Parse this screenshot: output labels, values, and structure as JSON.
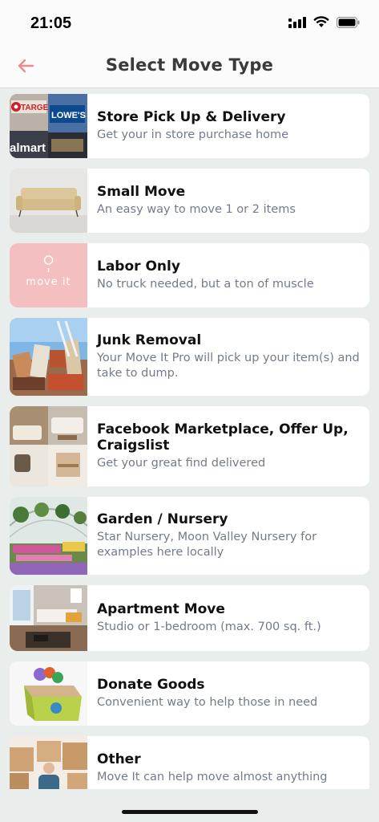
{
  "status": {
    "time": "21:05"
  },
  "nav": {
    "title": "Select Move Type",
    "back_icon": "arrow-left-icon",
    "accent": "#f08a8a"
  },
  "thumb_text": {
    "target": "TARGET",
    "lowes": "LOWE'S",
    "walmart": "almart",
    "moveit": "move it"
  },
  "items": [
    {
      "title": "Store Pick Up & Delivery",
      "subtitle": "Get your in store purchase home"
    },
    {
      "title": "Small Move",
      "subtitle": "An easy way to move 1 or 2 items"
    },
    {
      "title": "Labor Only",
      "subtitle": "No truck needed, but a ton of muscle"
    },
    {
      "title": "Junk Removal",
      "subtitle": "Your Move It Pro will pick up your item(s) and take to dump."
    },
    {
      "title": "Facebook Marketplace, Offer Up, Craigslist",
      "subtitle": "Get your great find delivered"
    },
    {
      "title": "Garden / Nursery",
      "subtitle": "Star Nursery, Moon Valley Nursery for examples here locally"
    },
    {
      "title": "Apartment Move",
      "subtitle": "Studio or 1-bedroom (max. 700 sq. ft.)"
    },
    {
      "title": "Donate Goods",
      "subtitle": "Convenient way to help those in need"
    },
    {
      "title": "Other",
      "subtitle": "Move It can help move almost anything"
    }
  ]
}
